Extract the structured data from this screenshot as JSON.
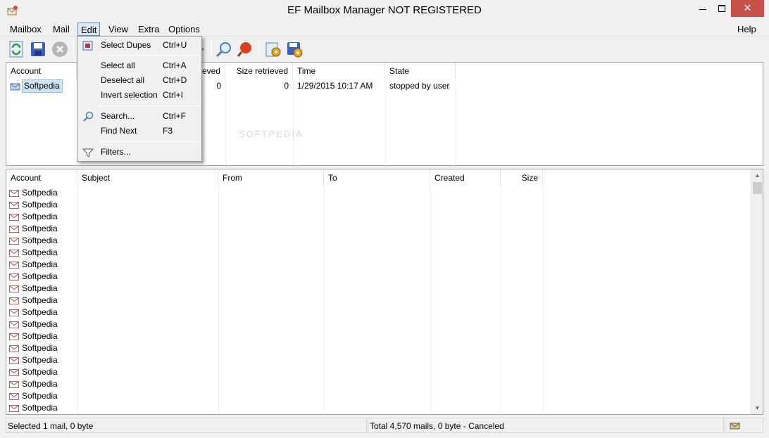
{
  "window": {
    "title": "EF Mailbox Manager NOT REGISTERED"
  },
  "menubar": {
    "items": [
      "Mailbox",
      "Mail",
      "Edit",
      "View",
      "Extra",
      "Options"
    ],
    "help": "Help",
    "active": "Edit"
  },
  "toolbar": {
    "buttons": [
      "refresh-icon",
      "save-icon",
      "stop-icon",
      "search-icon",
      "paint-icon",
      "settings-gear-icon",
      "settings-save-icon"
    ]
  },
  "accounts_table": {
    "headers": {
      "account": "Account",
      "retrieved": "ieved",
      "size_retrieved": "Size retrieved",
      "time": "Time",
      "state": "State"
    },
    "row": {
      "account": "Softpedia",
      "retrieved": "0",
      "size_retrieved": "0",
      "time": "1/29/2015  10:17 AM",
      "state": "stopped by user"
    }
  },
  "mail_table": {
    "headers": {
      "account": "Account",
      "subject": "Subject",
      "from": "From",
      "to": "To",
      "created": "Created",
      "size": "Size"
    },
    "rows": [
      "Softpedia",
      "Softpedia",
      "Softpedia",
      "Softpedia",
      "Softpedia",
      "Softpedia",
      "Softpedia",
      "Softpedia",
      "Softpedia",
      "Softpedia",
      "Softpedia",
      "Softpedia",
      "Softpedia",
      "Softpedia",
      "Softpedia",
      "Softpedia",
      "Softpedia",
      "Softpedia",
      "Softpedia"
    ]
  },
  "edit_menu": {
    "items": [
      {
        "label": "Select Dupes",
        "shortcut": "Ctrl+U",
        "icon": "select-dupes-icon"
      },
      {
        "label": "Select all",
        "shortcut": "Ctrl+A"
      },
      {
        "label": "Deselect all",
        "shortcut": "Ctrl+D"
      },
      {
        "label": "Invert selection",
        "shortcut": "Ctrl+I"
      },
      {
        "label": "Search...",
        "shortcut": "Ctrl+F",
        "icon": "magnifier-icon"
      },
      {
        "label": "Find Next",
        "shortcut": "F3"
      },
      {
        "label": "Filters...",
        "shortcut": "",
        "icon": "filter-icon"
      }
    ]
  },
  "statusbar": {
    "left": "Selected 1 mail, 0 byte",
    "right": "Total 4,570 mails, 0 byte - Canceled"
  },
  "watermark": "SOFTPEDIA",
  "colors": {
    "selection": "#cde4f7",
    "close_button": "#c7504b",
    "menu_active": "#dce8f7"
  }
}
